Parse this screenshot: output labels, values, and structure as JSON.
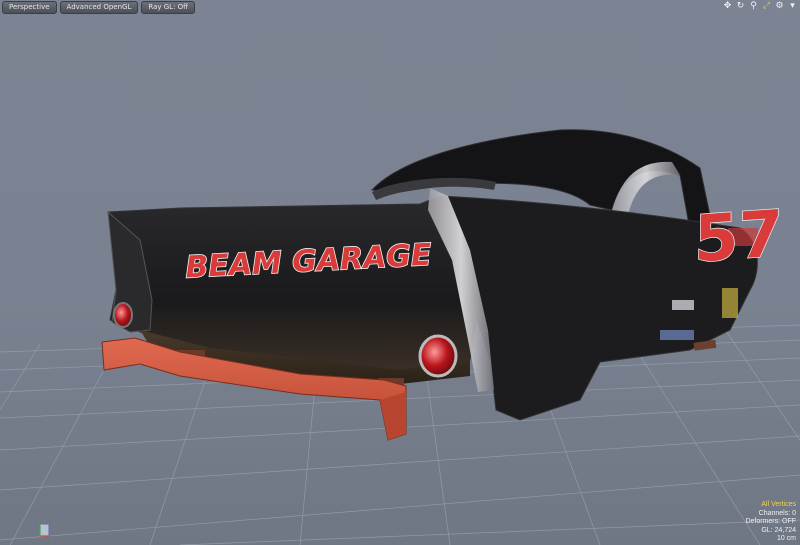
{
  "viewport": {
    "buttons": [
      {
        "label": "Perspective"
      },
      {
        "label": "Advanced OpenGL"
      },
      {
        "label": "Ray GL: Off"
      }
    ],
    "tools": [
      "move-view-icon",
      "rotate-view-icon",
      "zoom-view-icon",
      "fit-view-icon",
      "settings-icon",
      "expand-icon"
    ]
  },
  "car": {
    "decal_text": "BEAM GARAGE",
    "number": "57"
  },
  "info": {
    "selection_mode": "All Vertices",
    "channels": "Channels: 0",
    "deformers": "Deformers: OFF",
    "gl": "GL: 24,724",
    "grid": "10 cm"
  },
  "colors": {
    "background": "#7c8493",
    "grid": "#9aa2b0",
    "car_body": "#1c1b1d",
    "bumper": "#d65b42",
    "decal": "#d93b3b",
    "highlight": "#f4d348"
  }
}
